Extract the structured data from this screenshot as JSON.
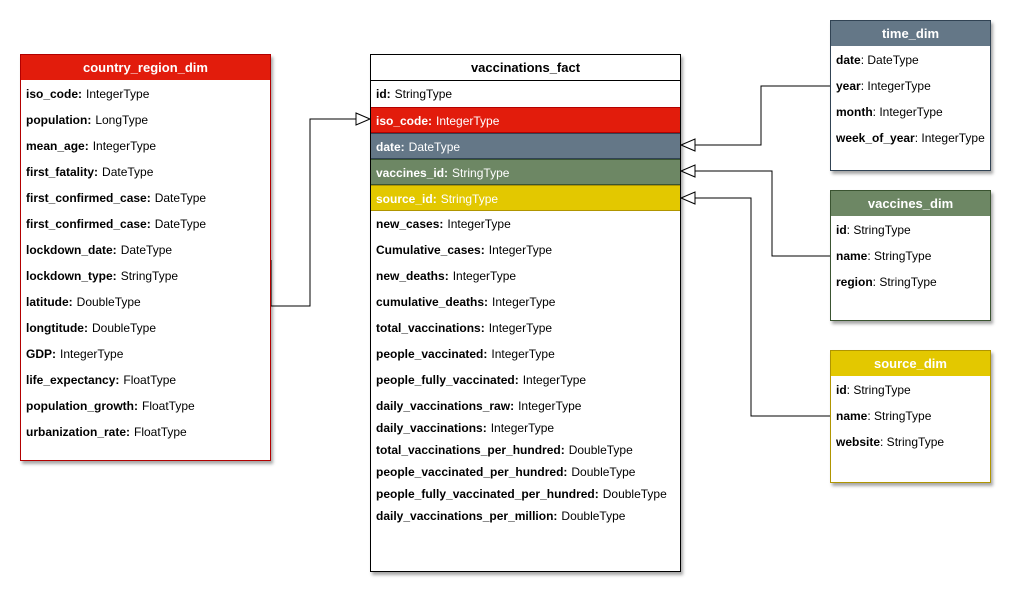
{
  "colors": {
    "red": "#e21c0c",
    "slate": "#647787",
    "green": "#6d8764",
    "yellow": "#e3c800",
    "border_red": "#b20000",
    "border_slate": "#314354",
    "border_green": "#3a5431",
    "border_yellow": "#b09500"
  },
  "country_region_dim": {
    "title": "country_region_dim",
    "fields": [
      {
        "name": "iso_code:",
        "type": "IntegerType"
      },
      {
        "name": "population:",
        "type": "LongType"
      },
      {
        "name": "mean_age:",
        "type": "IntegerType"
      },
      {
        "name": "first_fatality:",
        "type": "DateType"
      },
      {
        "name": "first_confirmed_case:",
        "type": "DateType"
      },
      {
        "name": "first_confirmed_case:",
        "type": "DateType"
      },
      {
        "name": "lockdown_date:",
        "type": "DateType"
      },
      {
        "name": "lockdown_type:",
        "type": "StringType"
      },
      {
        "name": "latitude:",
        "type": "DoubleType"
      },
      {
        "name": "longtitude:",
        "type": "DoubleType"
      },
      {
        "name": "GDP:",
        "type": "IntegerType"
      },
      {
        "name": "life_expectancy:",
        "type": "FloatType"
      },
      {
        "name": "population_growth:",
        "type": "FloatType"
      },
      {
        "name": "urbanization_rate:",
        "type": "FloatType"
      }
    ]
  },
  "vaccinations_fact": {
    "title": "vaccinations_fact",
    "fields": [
      {
        "name": "id:",
        "type": "StringType"
      },
      {
        "name": "iso_code:",
        "type": "IntegerType"
      },
      {
        "name": "date:",
        "type": "DateType"
      },
      {
        "name": "vaccines_id:",
        "type": "StringType"
      },
      {
        "name": "source_id:",
        "type": "StringType"
      },
      {
        "name": "new_cases:",
        "type": "IntegerType"
      },
      {
        "name": "Cumulative_cases:",
        "type": "IntegerType"
      },
      {
        "name": "new_deaths:",
        "type": "IntegerType"
      },
      {
        "name": "cumulative_deaths:",
        "type": "IntegerType"
      },
      {
        "name": "total_vaccinations:",
        "type": "IntegerType"
      },
      {
        "name": "people_vaccinated:",
        "type": "IntegerType"
      },
      {
        "name": "people_fully_vaccinated:",
        "type": "IntegerType"
      },
      {
        "name": "daily_vaccinations_raw:",
        "type": "IntegerType"
      },
      {
        "name": "daily_vaccinations:",
        "type": "IntegerType"
      },
      {
        "name": "total_vaccinations_per_hundred:",
        "type": "DoubleType"
      },
      {
        "name": "people_vaccinated_per_hundred:",
        "type": "DoubleType"
      },
      {
        "name": "people_fully_vaccinated_per_hundred:",
        "type": "DoubleType"
      },
      {
        "name": "daily_vaccinations_per_million:",
        "type": "DoubleType"
      }
    ]
  },
  "time_dim": {
    "title": "time_dim",
    "fields": [
      {
        "name": "date",
        "type": ": DateType"
      },
      {
        "name": "year",
        "type": ": IntegerType"
      },
      {
        "name": "month",
        "type": ": IntegerType"
      },
      {
        "name": "week_of_year",
        "type": ": IntegerType"
      }
    ]
  },
  "vaccines_dim": {
    "title": "vaccines_dim",
    "fields": [
      {
        "name": "id",
        "type": ": StringType"
      },
      {
        "name": "name",
        "type": ": StringType"
      },
      {
        "name": "region",
        "type": ": StringType"
      }
    ]
  },
  "source_dim": {
    "title": "source_dim",
    "fields": [
      {
        "name": "id",
        "type": ": StringType"
      },
      {
        "name": "name",
        "type": ": StringType"
      },
      {
        "name": "website",
        "type": ": StringType"
      }
    ]
  }
}
